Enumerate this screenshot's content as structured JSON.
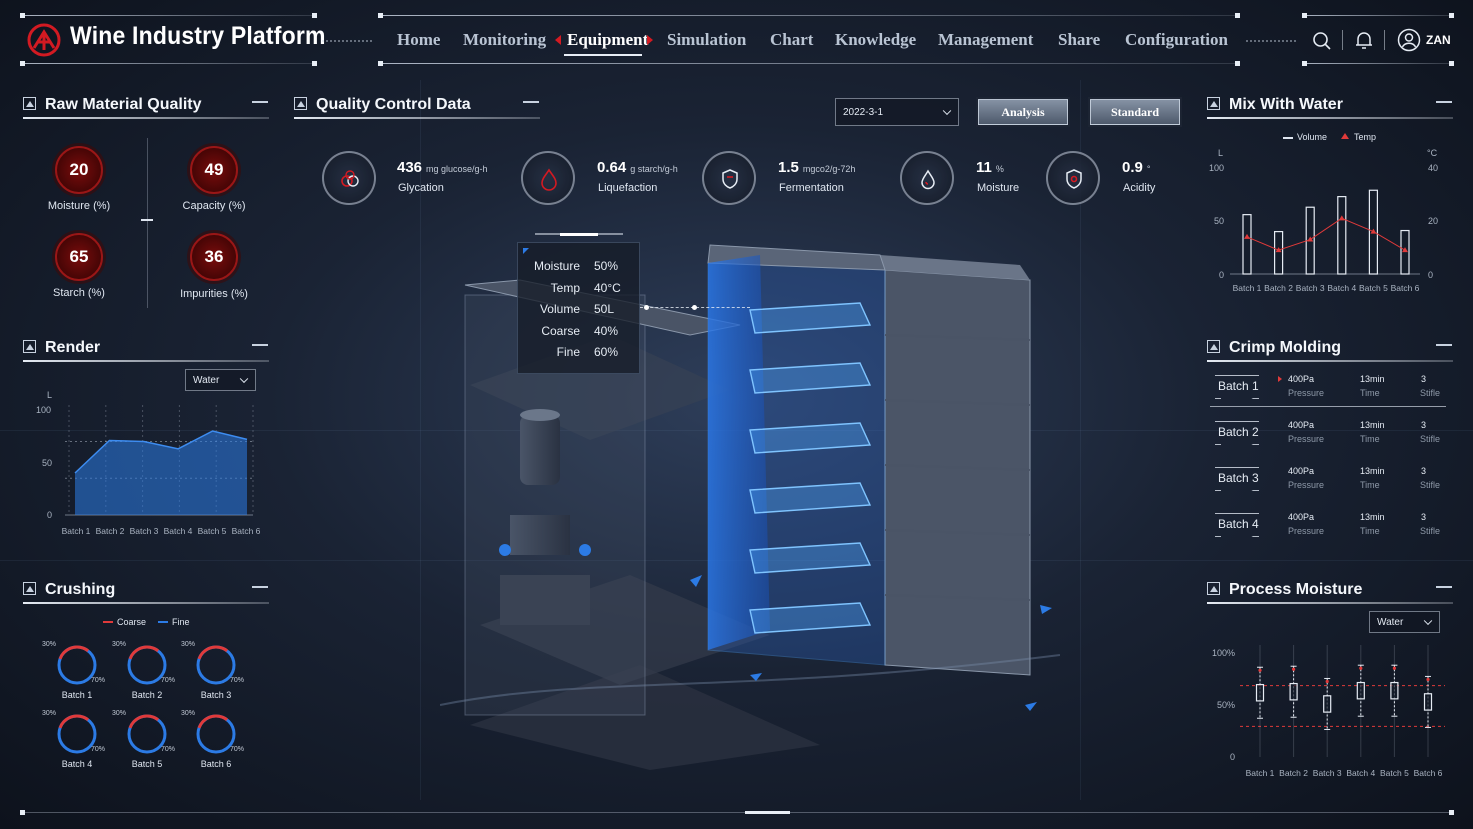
{
  "app": {
    "title": "Wine Industry Platform",
    "user": "ZAN"
  },
  "nav": [
    "Home",
    "Monitoring",
    "Equipment",
    "Simulation",
    "Chart",
    "Knowledge",
    "Management",
    "Share",
    "Configuration"
  ],
  "active_nav": "Equipment",
  "icons": [
    "logo-icon",
    "search-icon",
    "bell-icon",
    "user-icon"
  ],
  "colors": {
    "accent_red": "#c8141c",
    "accent_blue": "#2c7be5",
    "line_red": "#e03a3a"
  },
  "raw_material": {
    "title": "Raw Material Quality",
    "gauges": [
      {
        "value": "20",
        "label": "Moisture (%)"
      },
      {
        "value": "49",
        "label": "Capacity (%)"
      },
      {
        "value": "65",
        "label": "Starch (%)"
      },
      {
        "value": "36",
        "label": "Impurities (%)"
      }
    ]
  },
  "quality_control": {
    "title": "Quality Control Data",
    "date": "2022-3-1",
    "analysis_btn": "Analysis",
    "standard_btn": "Standard",
    "items": [
      {
        "value": "436",
        "unit": "mg glucose/g-h",
        "name": "Glycation"
      },
      {
        "value": "0.64",
        "unit": "g starch/g-h",
        "name": "Liquefaction"
      },
      {
        "value": "1.5",
        "unit": "mgco2/g-72h",
        "name": "Fermentation"
      },
      {
        "value": "11",
        "unit": "%",
        "name": "Moisture"
      },
      {
        "value": "0.9",
        "unit": "°",
        "name": "Acidity"
      }
    ]
  },
  "tooltip": {
    "rows": [
      {
        "label": "Moisture",
        "value": "50%"
      },
      {
        "label": "Temp",
        "value": "40°C"
      },
      {
        "label": "Volume",
        "value": "50L"
      },
      {
        "label": "Coarse",
        "value": "40%"
      },
      {
        "label": "Fine",
        "value": "60%"
      }
    ]
  },
  "render": {
    "title": "Render",
    "select": "Water",
    "yunit": "L",
    "ticks": [
      "100",
      "50",
      "0"
    ]
  },
  "crushing": {
    "title": "Crushing",
    "legend": [
      "Coarse",
      "Fine"
    ],
    "batches": [
      "Batch 1",
      "Batch 2",
      "Batch 3",
      "Batch 4",
      "Batch 5",
      "Batch 6"
    ],
    "left_pct": "30%",
    "right_pct": "70%"
  },
  "mix_water": {
    "title": "Mix With Water",
    "legend": [
      "Volume",
      "Temp"
    ],
    "yleft_unit": "L",
    "yright_unit": "°C",
    "left_ticks": [
      "100",
      "50",
      "0"
    ],
    "right_ticks": [
      "40",
      "20",
      "0"
    ]
  },
  "crimp": {
    "title": "Crimp Molding",
    "rows": [
      {
        "batch": "Batch 1",
        "pressure": "400Pa",
        "pressure_label": "Pressure",
        "time": "13min",
        "time_label": "Time",
        "stifle": "3",
        "stifle_label": "Stifle"
      },
      {
        "batch": "Batch 2",
        "pressure": "400Pa",
        "pressure_label": "Pressure",
        "time": "13min",
        "time_label": "Time",
        "stifle": "3",
        "stifle_label": "Stifle"
      },
      {
        "batch": "Batch 3",
        "pressure": "400Pa",
        "pressure_label": "Pressure",
        "time": "13min",
        "time_label": "Time",
        "stifle": "3",
        "stifle_label": "Stifle"
      },
      {
        "batch": "Batch 4",
        "pressure": "400Pa",
        "pressure_label": "Pressure",
        "time": "13min",
        "time_label": "Time",
        "stifle": "3",
        "stifle_label": "Stifle"
      }
    ]
  },
  "process_moisture": {
    "title": "Process Moisture",
    "select": "Water",
    "ticks": [
      "100%",
      "50%",
      "0"
    ]
  },
  "chart_data": [
    {
      "type": "area",
      "categories": [
        "Batch 1",
        "Batch 2",
        "Batch 3",
        "Batch 4",
        "Batch 5",
        "Batch 6"
      ],
      "values": [
        40,
        71,
        70,
        63,
        80,
        72
      ],
      "ylim": [
        0,
        100
      ],
      "grid": true
    },
    {
      "type": "pie",
      "categories": [
        "Coarse",
        "Fine"
      ],
      "values": [
        30,
        70
      ]
    },
    {
      "type": "bar",
      "categories": [
        "Batch 1",
        "Batch 2",
        "Batch 3",
        "Batch 4",
        "Batch 5",
        "Batch 6"
      ],
      "series": [
        {
          "name": "Volume",
          "values": [
            56,
            40,
            63,
            73,
            79,
            41
          ]
        },
        {
          "name": "Temp",
          "values": [
            14,
            9,
            13,
            21,
            16,
            9
          ]
        }
      ],
      "ylim": [
        0,
        100
      ],
      "y2lim": [
        0,
        40
      ]
    },
    {
      "type": "scatter",
      "categories": [
        "Batch 1",
        "Batch 2",
        "Batch 3",
        "Batch 4",
        "Batch 5",
        "Batch 6"
      ],
      "values": [
        63,
        64,
        52,
        65,
        65,
        54
      ],
      "ylim": [
        0,
        100
      ]
    }
  ]
}
